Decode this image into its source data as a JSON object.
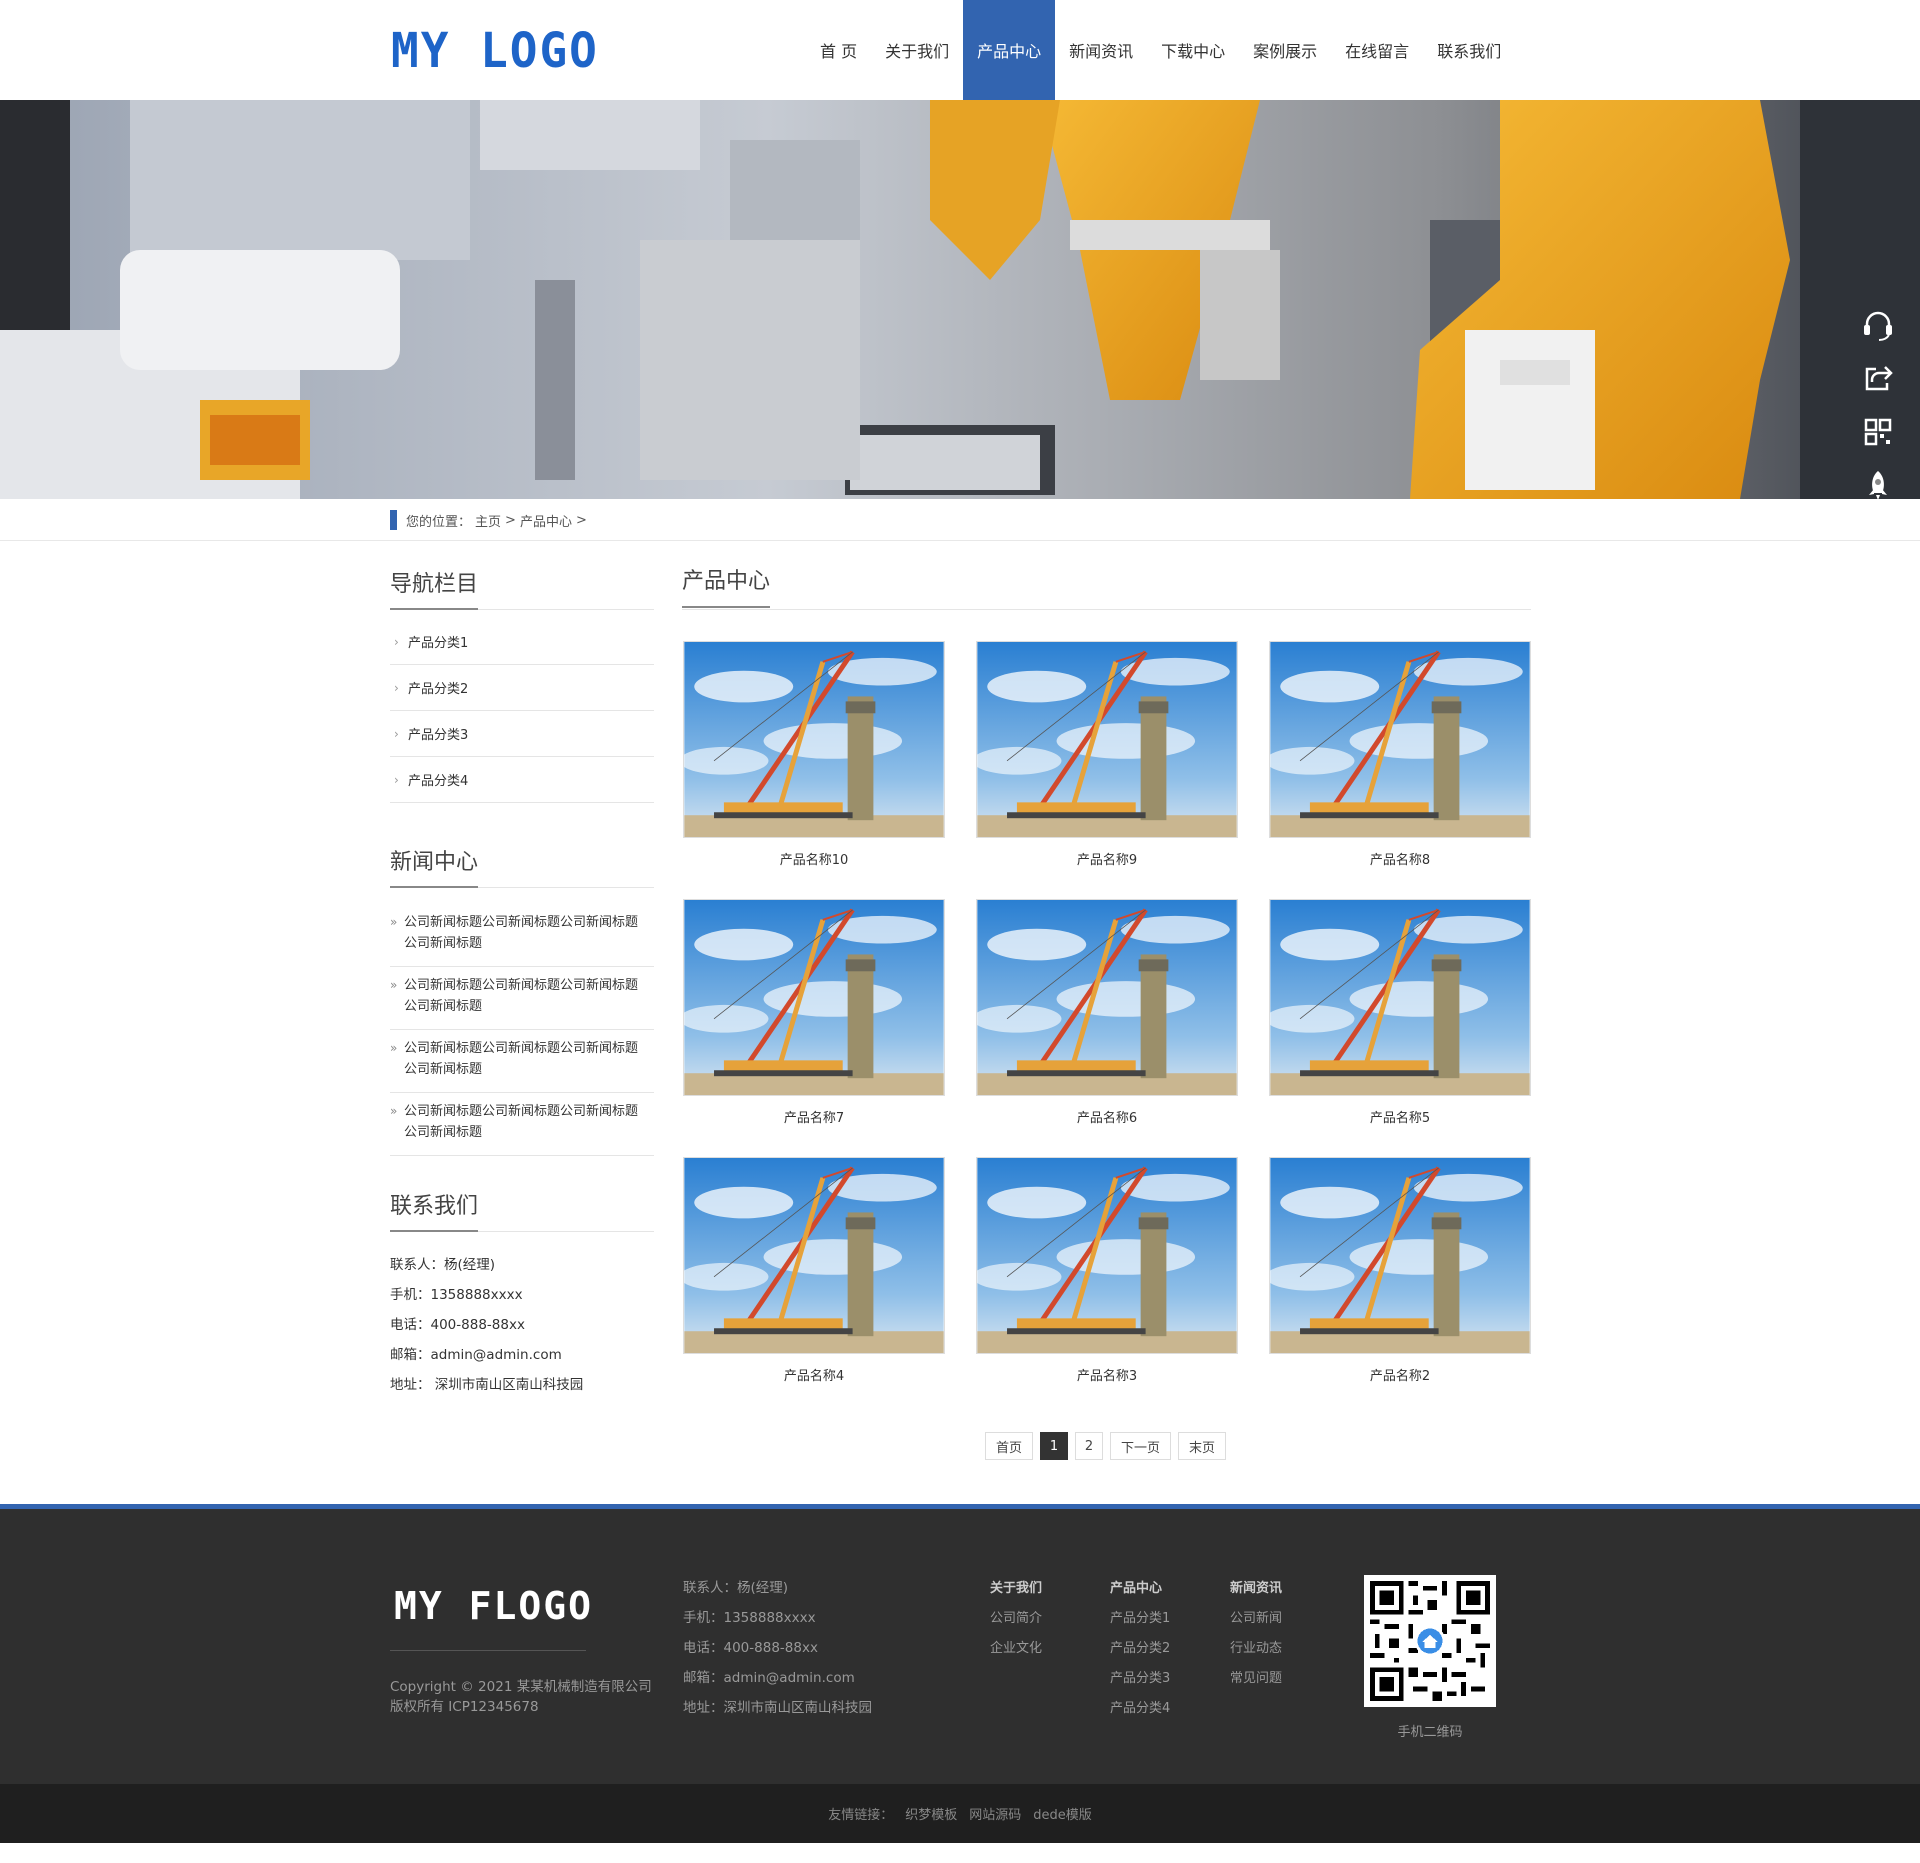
{
  "header": {
    "logo": "MY LOGO",
    "nav": [
      "首 页",
      "关于我们",
      "产品中心",
      "新闻资讯",
      "下载中心",
      "案例展示",
      "在线留言",
      "联系我们"
    ],
    "active_nav": "产品中心"
  },
  "side_tools": [
    "headset-icon",
    "share-icon",
    "qrcode-icon",
    "rocket-icon"
  ],
  "breadcrumb": {
    "prefix": "您的位置：",
    "items": [
      "主页",
      ">",
      "产品中心",
      ">"
    ]
  },
  "sidebar": {
    "nav_title": "导航栏目",
    "categories": [
      "产品分类1",
      "产品分类2",
      "产品分类3",
      "产品分类4"
    ],
    "news_title": "新闻中心",
    "news": [
      "公司新闻标题公司新闻标题公司新闻标题公司新闻标题",
      "公司新闻标题公司新闻标题公司新闻标题公司新闻标题",
      "公司新闻标题公司新闻标题公司新闻标题公司新闻标题",
      "公司新闻标题公司新闻标题公司新闻标题公司新闻标题"
    ],
    "contact_title": "联系我们",
    "contact": [
      "联系人：杨(经理)",
      "手机：1358888xxxx",
      "电话：400-888-88xx",
      "邮箱：admin@admin.com",
      "地址： 深圳市南山区南山科技园"
    ]
  },
  "main": {
    "title": "产品中心",
    "products": [
      "产品名称10",
      "产品名称9",
      "产品名称8",
      "产品名称7",
      "产品名称6",
      "产品名称5",
      "产品名称4",
      "产品名称3",
      "产品名称2"
    ],
    "pager": {
      "first": "首页",
      "pages": [
        "1",
        "2"
      ],
      "current": "1",
      "next": "下一页",
      "last": "末页"
    }
  },
  "footer": {
    "logo": "MY FLOGO",
    "copyright": "Copyright © 2021 某某机械制造有限公司 版权所有 ICP12345678",
    "contact": [
      "联系人：杨(经理)",
      "手机：1358888xxxx",
      "电话：400-888-88xx",
      "邮箱：admin@admin.com",
      "地址：深圳市南山区南山科技园"
    ],
    "columns": [
      {
        "title": "关于我们",
        "links": [
          "公司简介",
          "企业文化"
        ]
      },
      {
        "title": "产品中心",
        "links": [
          "产品分类1",
          "产品分类2",
          "产品分类3",
          "产品分类4"
        ]
      },
      {
        "title": "新闻资讯",
        "links": [
          "公司新闻",
          "行业动态",
          "常见问题"
        ]
      }
    ],
    "qr_label": "手机二维码",
    "friend_links_label": "友情链接：",
    "friend_links": [
      "织梦模板",
      "网站源码",
      "dede模版"
    ]
  },
  "colors": {
    "brand_blue": "#3264b0",
    "logo_blue": "#1e64c8",
    "footer_bg": "#2f2f2f",
    "links_bar_bg": "#1f1f1f"
  }
}
